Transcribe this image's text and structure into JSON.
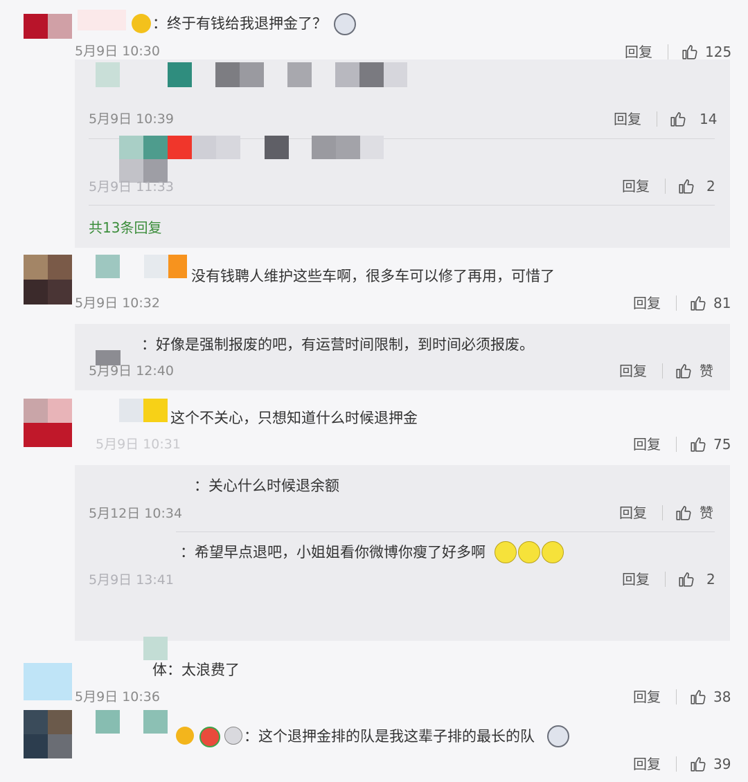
{
  "comments": [
    {
      "text": "：终于有钱给我退押金了？",
      "time": "5月9日 10:30",
      "reply_label": "回复",
      "likes": "125",
      "replies": [
        {
          "text": "",
          "time": "5月9日 10:39",
          "reply_label": "回复",
          "likes": "14"
        },
        {
          "text": "",
          "time": "5月9日 11:33",
          "reply_label": "回复",
          "likes": "2"
        }
      ],
      "more_replies": "共13条回复"
    },
    {
      "text": "没有钱聘人维护这些车啊，很多车可以修了再用，可惜了",
      "time": "5月9日 10:32",
      "reply_label": "回复",
      "likes": "81",
      "replies": [
        {
          "text": "：好像是强制报废的吧，有运营时间限制，到时间必须报废。",
          "time": "5月9日 12:40",
          "reply_label": "回复",
          "likes": "赞"
        }
      ]
    },
    {
      "text": "这个不关心，只想知道什么时候退押金",
      "time": "5月9日 10:31",
      "reply_label": "回复",
      "likes": "75",
      "replies": [
        {
          "text": "：关心什么时候退余额",
          "time": "5月12日 10:34",
          "reply_label": "回复",
          "likes": "赞"
        },
        {
          "text": "：希望早点退吧，小姐姐看你微博你瘦了好多啊",
          "time": "5月9日 13:41",
          "reply_label": "回复",
          "likes": "2"
        }
      ]
    },
    {
      "text": "体：太浪费了",
      "time": "5月9日 10:36",
      "reply_label": "回复",
      "likes": "38",
      "replies": []
    },
    {
      "text": "：这个退押金排的队是我这辈子排的最长的队",
      "time": "",
      "reply_label": "回复",
      "likes": "39",
      "replies": []
    }
  ],
  "colors": {
    "background": "#f6f6f8",
    "reply_panel": "#ececef",
    "more_link": "#3b8d3b"
  }
}
